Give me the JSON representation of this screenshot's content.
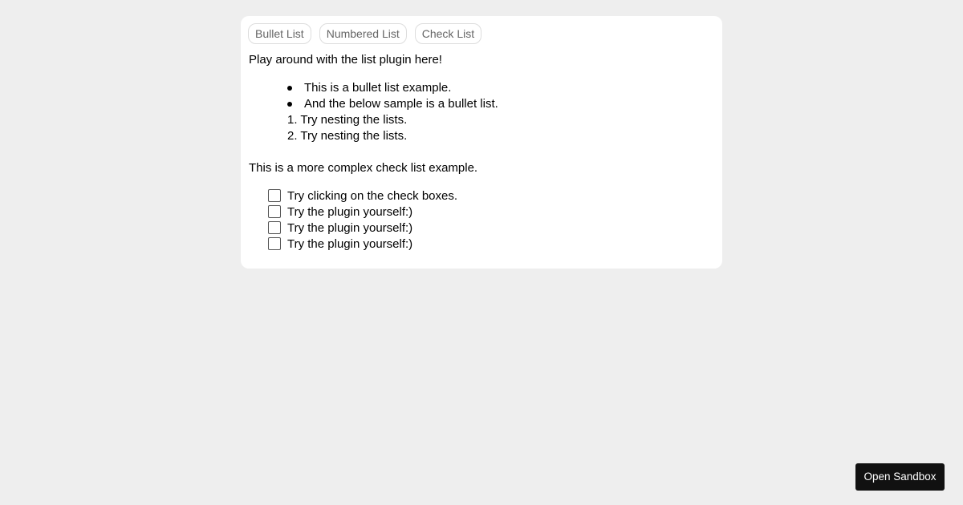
{
  "toolbar": {
    "buttons": [
      {
        "label": "Bullet List"
      },
      {
        "label": "Numbered List"
      },
      {
        "label": "Check List"
      }
    ]
  },
  "editor": {
    "intro": "Play around with the list plugin here!",
    "bullet_list": [
      "This is a bullet list example.",
      "And the below sample is a bullet list."
    ],
    "numbered_list": [
      {
        "marker": "1.",
        "text": "Try nesting the lists."
      },
      {
        "marker": "2.",
        "text": "Try nesting the lists."
      }
    ],
    "check_intro": "This is a more complex check list example.",
    "check_list": [
      {
        "text": "Try clicking on the check boxes.",
        "checked": false
      },
      {
        "text": "Try the plugin yourself:)",
        "checked": false
      },
      {
        "text": "Try the plugin yourself:)",
        "checked": false
      },
      {
        "text": "Try the plugin yourself:)",
        "checked": false
      }
    ]
  },
  "sandbox_button": {
    "label": "Open Sandbox"
  },
  "colors": {
    "background": "#eeeeee",
    "card": "#ffffff",
    "button_text": "#666666",
    "button_border": "#dddddd",
    "sandbox_bg": "#111111",
    "sandbox_text": "#ffffff"
  }
}
